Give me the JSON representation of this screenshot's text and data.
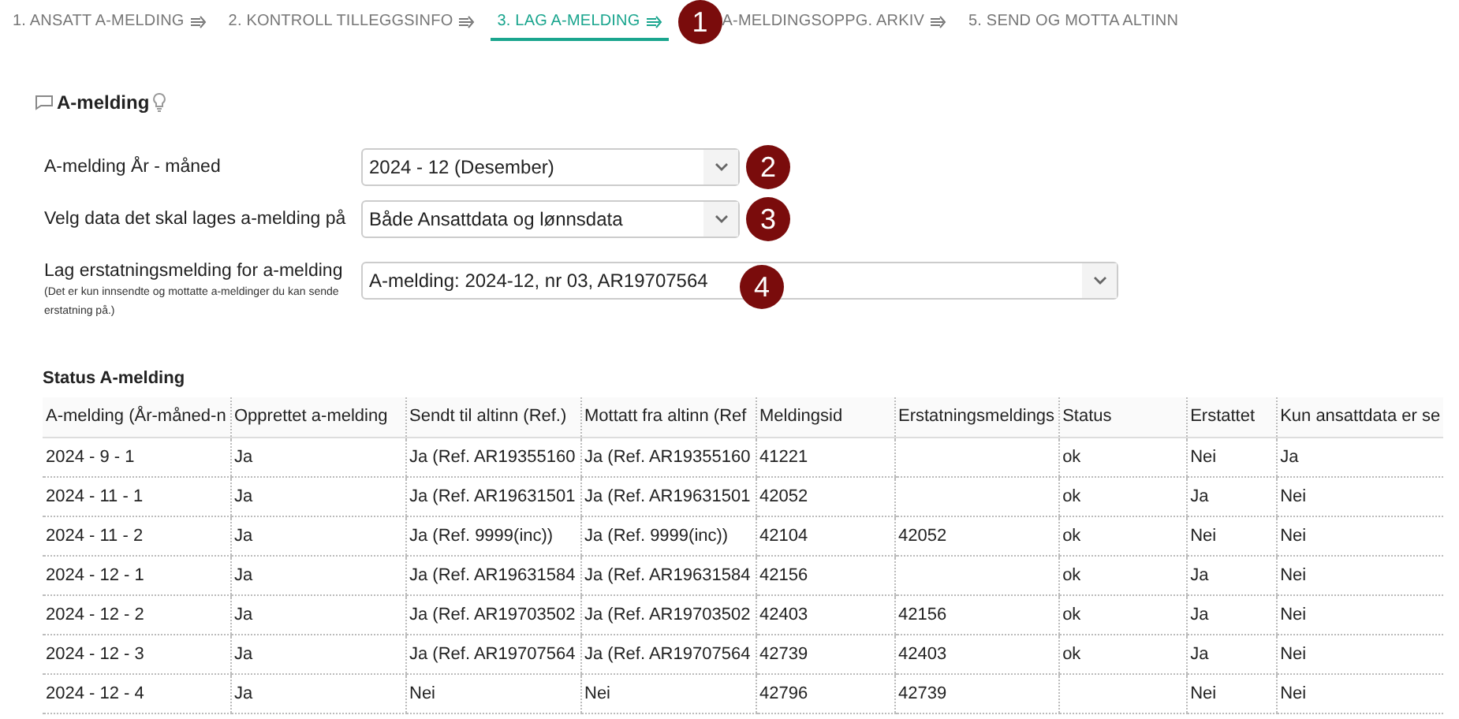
{
  "tabs": [
    {
      "label": "1. ANSATT A-MELDING",
      "selected": false
    },
    {
      "label": "2. KONTROLL TILLEGGSINFO",
      "selected": false
    },
    {
      "label": "3. LAG A-MELDING",
      "selected": true
    },
    {
      "label": "A-MELDINGSOPPG. ARKIV",
      "selected": false
    },
    {
      "label": "5. SEND OG MOTTA ALTINN",
      "selected": false
    }
  ],
  "section": {
    "title": "A-melding"
  },
  "form": [
    {
      "label": "A-melding År - måned",
      "value": "2024 - 12 (Desember)",
      "kind": "short"
    },
    {
      "label": "Velg data det skal lages a-melding på",
      "value": "Både Ansattdata og lønnsdata",
      "kind": "short"
    },
    {
      "label": "Lag erstatningsmelding for a-melding",
      "note": "(Det er kun innsendte og mottatte a-meldinger du kan sende erstatning på.)",
      "value": "A-melding: 2024-12, nr 03, AR19707564",
      "kind": "wide"
    }
  ],
  "table": {
    "title": "Status A-melding",
    "columns": [
      "A-melding (År-måned-n",
      "Opprettet a-melding",
      "Sendt til altinn (Ref.)",
      "Mottatt fra altinn (Ref",
      "Meldingsid",
      "Erstatningsmeldings",
      "Status",
      "Erstattet",
      "Kun ansattdata er se"
    ],
    "rows": [
      [
        "2024 - 9 - 1",
        "Ja",
        "Ja (Ref. AR19355160",
        "Ja (Ref. AR19355160",
        "41221",
        "",
        "ok",
        "Nei",
        "Ja"
      ],
      [
        "2024 - 11 - 1",
        "Ja",
        "Ja (Ref. AR19631501",
        "Ja (Ref. AR19631501",
        "42052",
        "",
        "ok",
        "Ja",
        "Nei"
      ],
      [
        "2024 - 11 - 2",
        "Ja",
        "Ja (Ref. 9999(inc))",
        "Ja (Ref. 9999(inc))",
        "42104",
        "42052",
        "ok",
        "Nei",
        "Nei"
      ],
      [
        "2024 - 12 - 1",
        "Ja",
        "Ja (Ref. AR19631584",
        "Ja (Ref. AR19631584",
        "42156",
        "",
        "ok",
        "Ja",
        "Nei"
      ],
      [
        "2024 - 12 - 2",
        "Ja",
        "Ja (Ref. AR19703502",
        "Ja (Ref. AR19703502",
        "42403",
        "42156",
        "ok",
        "Ja",
        "Nei"
      ],
      [
        "2024 - 12 - 3",
        "Ja",
        "Ja (Ref. AR19707564",
        "Ja (Ref. AR19707564",
        "42739",
        "42403",
        "ok",
        "Ja",
        "Nei"
      ],
      [
        "2024 - 12 - 4",
        "Ja",
        "Nei",
        "Nei",
        "42796",
        "42739",
        "",
        "Nei",
        "Nei"
      ]
    ]
  },
  "annotations": [
    {
      "label": "1"
    },
    {
      "label": "2"
    },
    {
      "label": "3"
    },
    {
      "label": "4"
    }
  ]
}
